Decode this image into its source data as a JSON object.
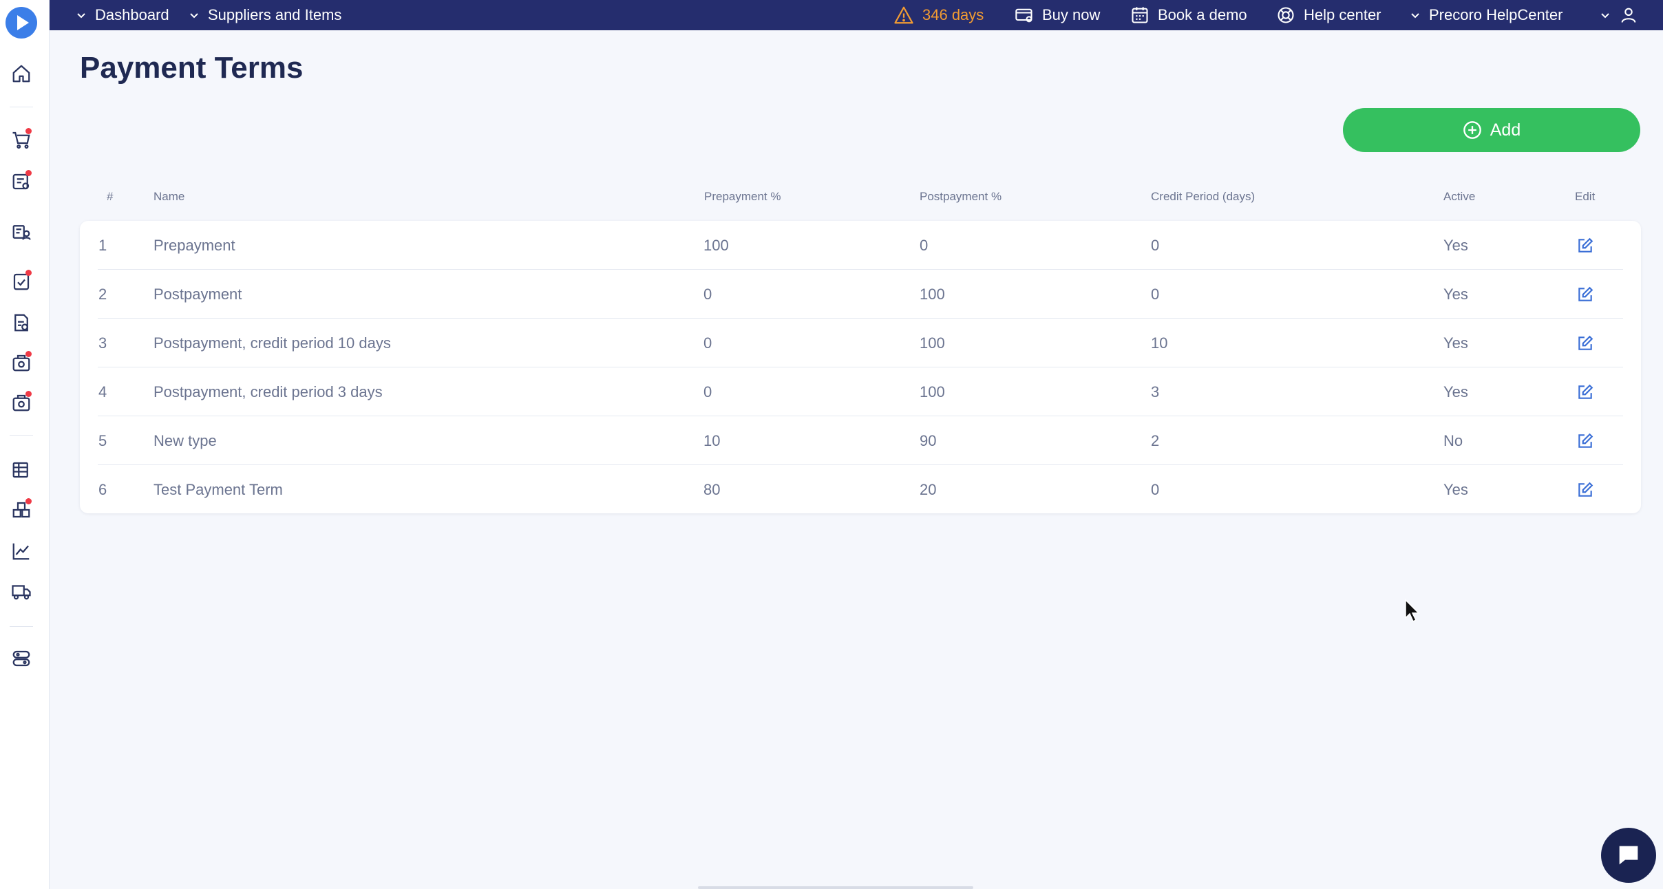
{
  "topbar": {
    "nav1": "Dashboard",
    "nav2": "Suppliers and Items",
    "trial": "346 days",
    "buy": "Buy now",
    "demo": "Book a demo",
    "help": "Help center",
    "company": "Precoro HelpCenter"
  },
  "sidebar": {
    "icons": [
      "home-icon",
      "cart-icon",
      "requisition-icon",
      "supplier-icon",
      "approval-icon",
      "invoice-icon",
      "budget-icon",
      "payment-icon",
      "catalog-icon",
      "inventory-icon",
      "analytics-icon",
      "delivery-icon",
      "settings-icon"
    ]
  },
  "page": {
    "title": "Payment Terms",
    "add_label": "Add"
  },
  "table": {
    "headers": [
      "#",
      "Name",
      "Prepayment %",
      "Postpayment %",
      "Credit Period (days)",
      "Active",
      "Edit"
    ],
    "rows": [
      {
        "num": "1",
        "name": "Prepayment",
        "prepayment": "100",
        "postpayment": "0",
        "credit": "0",
        "active": "Yes"
      },
      {
        "num": "2",
        "name": "Postpayment",
        "prepayment": "0",
        "postpayment": "100",
        "credit": "0",
        "active": "Yes"
      },
      {
        "num": "3",
        "name": "Postpayment, credit period 10 days",
        "prepayment": "0",
        "postpayment": "100",
        "credit": "10",
        "active": "Yes"
      },
      {
        "num": "4",
        "name": "Postpayment, credit period 3 days",
        "prepayment": "0",
        "postpayment": "100",
        "credit": "3",
        "active": "Yes"
      },
      {
        "num": "5",
        "name": "New type",
        "prepayment": "10",
        "postpayment": "90",
        "credit": "2",
        "active": "No"
      },
      {
        "num": "6",
        "name": "Test Payment Term",
        "prepayment": "80",
        "postpayment": "20",
        "credit": "0",
        "active": "Yes"
      }
    ]
  },
  "colors": {
    "topbar": "#252d6e",
    "add_button": "#35c05f",
    "warning": "#f39c32",
    "notification_dot": "#ef3a46",
    "edit_icon": "#3b6fd6"
  }
}
